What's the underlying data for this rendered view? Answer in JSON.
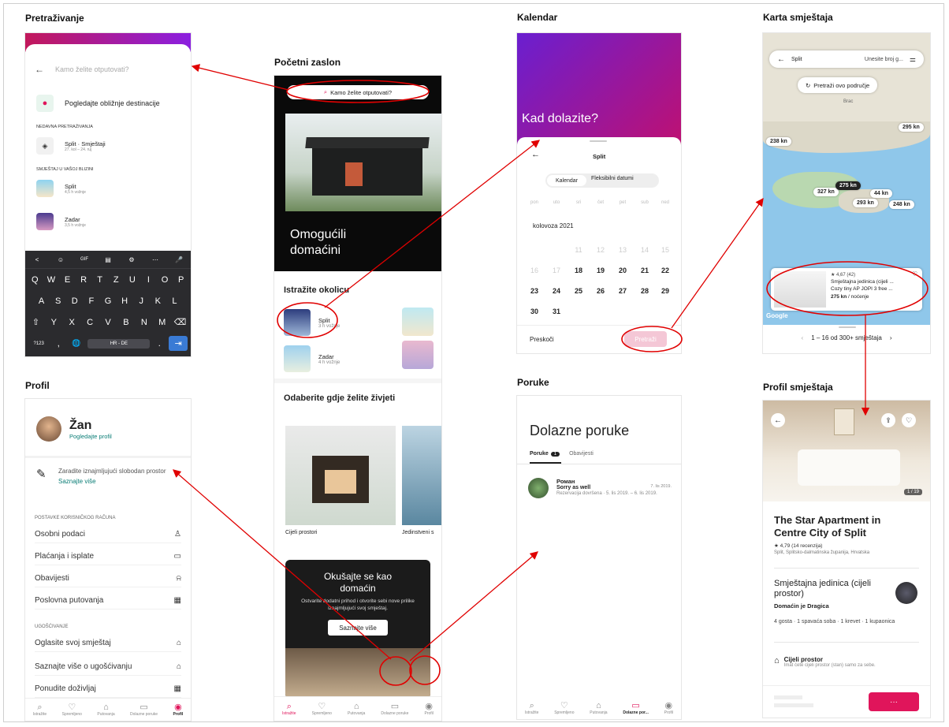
{
  "sections": {
    "search": "Pretraživanje",
    "home": "Početni zaslon",
    "calendar": "Kalendar",
    "map": "Karta smještaja",
    "profile": "Profil",
    "messages": "Poruke",
    "listing": "Profil smještaja"
  },
  "search": {
    "placeholder": "Kamo želite otputovati?",
    "nearby": "Pogledajte obližnje destinacije",
    "recent_header": "NEDAVNA PRETRAŽIVANJA",
    "recent_item": "Split · Smještaji",
    "recent_sub": "27. kol – 24. ruj",
    "vicinity_header": "SMJEŠTAJ U VAŠOJ BLIZINI",
    "split": "Split",
    "split_sub": "4,5 h vožnje",
    "zadar": "Zadar",
    "zadar_sub": "3,5 h vožnje"
  },
  "keyboard": {
    "top": [
      "<",
      "☺",
      "GIF",
      "▤",
      "⚙",
      "⋯",
      "🎤"
    ],
    "row1": [
      "Q",
      "W",
      "E",
      "R",
      "T",
      "Z",
      "U",
      "I",
      "O",
      "P"
    ],
    "row2": [
      "A",
      "S",
      "D",
      "F",
      "G",
      "H",
      "J",
      "K",
      "L"
    ],
    "row3": [
      "⇧",
      "Y",
      "X",
      "C",
      "V",
      "B",
      "N",
      "M",
      "⌫"
    ],
    "row4": [
      "?123",
      ",",
      "🌐",
      "HR - DE",
      ".",
      "⇥"
    ]
  },
  "home": {
    "search": "Kamo želite otputovati?",
    "hero": "Omogućili domaćini",
    "explore": "Istražite okolicu",
    "split": "Split",
    "split_sub": "3 h vožnje",
    "zadar": "Zadar",
    "zadar_sub": "4 h vožnje",
    "choose": "Odaberite gdje želite živjeti",
    "whole": "Cijeli prostori",
    "unique": "Jedinstveni s",
    "host_title": "Okušajte se kao domaćin",
    "host_text": "Ostvarite dodatni prihod i otvorite sebi nove prilike iznajmljujući svoj smještaj.",
    "host_btn": "Saznajte više",
    "nav": [
      "Istražite",
      "Spremljeno",
      "Putovanja",
      "Dolazne poruke",
      "Profil"
    ]
  },
  "calendar": {
    "header": "Kad dolazite?",
    "city": "Split",
    "tab1": "Kalendar",
    "tab2": "Fleksibilni datumi",
    "weekdays": [
      "pon",
      "uto",
      "sri",
      "čet",
      "pet",
      "sub",
      "ned"
    ],
    "month": "kolovoza 2021",
    "row1": [
      "11",
      "12",
      "13",
      "14",
      "15"
    ],
    "row2": [
      "16",
      "17",
      "18",
      "19",
      "20",
      "21",
      "22"
    ],
    "row3": [
      "23",
      "24",
      "25",
      "26",
      "27",
      "28",
      "29"
    ],
    "row4": [
      "30",
      "31"
    ],
    "skip": "Preskoči",
    "search": "Pretraži"
  },
  "map": {
    "city": "Split",
    "guests": "Unesite broj g...",
    "search_area": "Pretraži ovo područje",
    "prices": [
      "295 kn",
      "238 kn",
      "327 kn",
      "275 kn",
      "44 kn",
      "293 kn",
      "248 kn"
    ],
    "place_brac": "Brac",
    "rating": "★ 4,67 (42)",
    "card_title": "Smještajna jedinica (cijeli ...",
    "card_sub": "Cozy tiny AP JOPI 3 free ...",
    "card_price": "275 kn",
    "card_per": "/ noćenje",
    "google": "Google",
    "pages": "1 – 16 od 300+ smještaja"
  },
  "profile": {
    "name": "Žan",
    "view": "Pogledajte profil",
    "earn": "Zaradite iznajmljujući slobodan prostor",
    "more": "Saznajte više",
    "settings_header": "POSTAVKE KORISNIČKOG RAČUNA",
    "items": [
      "Osobni podaci",
      "Plaćanja i isplate",
      "Obavijesti",
      "Poslovna putovanja"
    ],
    "host_header": "UGOŠĆIVANJE",
    "host_items": [
      "Oglasite svoj smještaj",
      "Saznajte više o ugošćivanju",
      "Ponudite doživljaj"
    ],
    "nav": [
      "Istražite",
      "Spremljeno",
      "Putovanja",
      "Dolazne poruke",
      "Profil"
    ]
  },
  "messages": {
    "title": "Dolazne poruke",
    "tab1": "Poruke",
    "badge": "1",
    "tab2": "Obavijesti",
    "sender": "Роман",
    "date": "7. lis 2019.",
    "msg": "Sorry as well",
    "sub": "Rezervacija dovršena · 5. lis 2019. – 6. lis 2019.",
    "nav": [
      "Istražite",
      "Spremljeno",
      "Putovanja",
      "Dolazne por...",
      "Profil"
    ]
  },
  "listing": {
    "counter": "1 / 19",
    "title": "The Star Apartment in Centre City of Split",
    "rating": "★ 4,79 (14 recenzija)",
    "location": "Split, Splitsko-dalmatinska županija, Hrvatska",
    "type": "Smještajna jedinica (cijeli prostor)",
    "host": "Domaćin je Dragica",
    "details": "4 gosta · 1 spavaća soba · 1 krevet · 1 kupaonica",
    "whole": "Cijeli prostor",
    "whole_sub": "Imat ćete cijeli prostor (stan) samo za sebe.",
    "more": "···"
  },
  "colors": {
    "brand": "#e0155b",
    "annot": "#e00000",
    "purple": "#8b1fe0"
  }
}
